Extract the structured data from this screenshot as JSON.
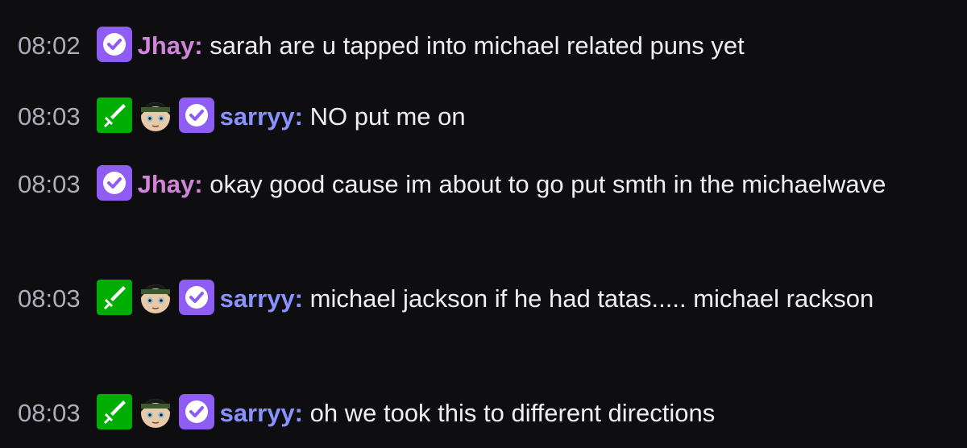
{
  "colors": {
    "background": "#0e0e10",
    "timestamp": "#adadb8",
    "text": "#efeff1",
    "jhay_name": "#d184d8",
    "sarryy_name": "#8a92ff",
    "verified_badge": "#8f5cf4",
    "moderator_badge": "#00ad03"
  },
  "messages": [
    {
      "time": "08:02",
      "badges": [
        "verified-badge-icon"
      ],
      "user": "Jhay",
      "text": "sarah are u tapped into michael related puns yet"
    },
    {
      "time": "08:03",
      "badges": [
        "moderator-sword-icon",
        "avatar-emote-icon",
        "verified-badge-icon"
      ],
      "user": "sarryy",
      "text": "NO put me on"
    },
    {
      "time": "08:03",
      "badges": [
        "verified-badge-icon"
      ],
      "user": "Jhay",
      "text": "okay good cause im about to go put smth in the michaelwave"
    },
    {
      "time": "08:03",
      "badges": [
        "moderator-sword-icon",
        "avatar-emote-icon",
        "verified-badge-icon"
      ],
      "user": "sarryy",
      "text": "michael jackson if he had tatas..... michael rackson"
    },
    {
      "time": "08:03",
      "badges": [
        "moderator-sword-icon",
        "avatar-emote-icon",
        "verified-badge-icon"
      ],
      "user": "sarryy",
      "text": "oh we took this to different directions"
    }
  ]
}
